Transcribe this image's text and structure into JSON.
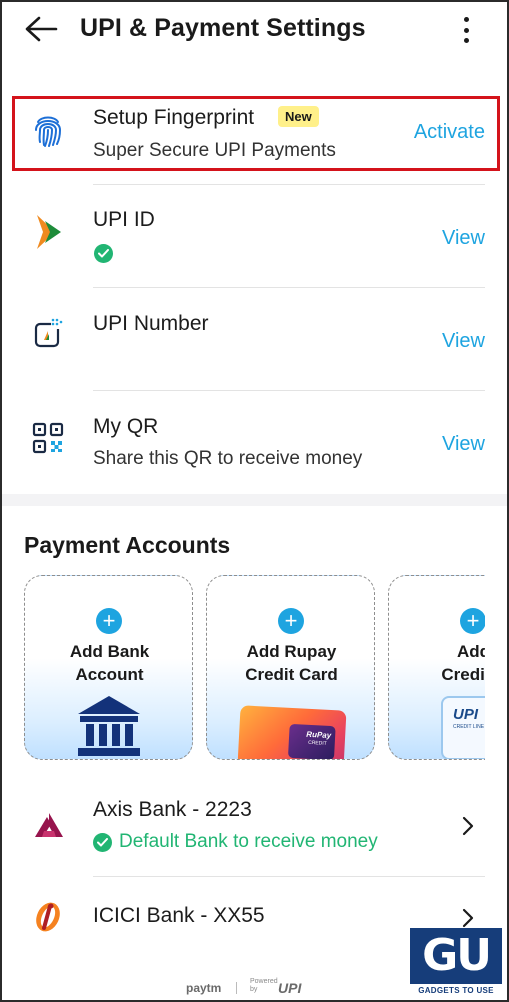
{
  "header": {
    "title": "UPI & Payment Settings",
    "back_icon": "arrow-left-icon",
    "menu_icon": "more-vertical-icon"
  },
  "settings": {
    "fingerprint": {
      "title": "Setup Fingerprint",
      "badge": "New",
      "subtitle": "Super Secure UPI Payments",
      "action": "Activate",
      "icon": "fingerprint-icon"
    },
    "upi_id": {
      "title": "UPI ID",
      "action": "View",
      "icon": "bhim-upi-icon",
      "status_icon": "check-circle-icon"
    },
    "upi_number": {
      "title": "UPI Number",
      "action": "View",
      "icon": "phone-number-icon"
    },
    "my_qr": {
      "title": "My QR",
      "subtitle": "Share this QR to receive money",
      "action": "View",
      "icon": "qr-code-icon"
    }
  },
  "payment_accounts": {
    "title": "Payment Accounts",
    "cards": [
      {
        "line1": "Add Bank",
        "line2": "Account",
        "icon": "bank-building-icon"
      },
      {
        "line1": "Add Rupay",
        "line2": "Credit Card",
        "icon": "rupay-card-icon",
        "card_text": "RuPay",
        "card_sub": "CREDIT"
      },
      {
        "line1": "Add",
        "line2": "Credit L",
        "icon": "upi-credit-line-icon",
        "card_text": "UPI",
        "card_sub": "CREDIT LINE"
      }
    ]
  },
  "banks": [
    {
      "name": "Axis Bank - 2223",
      "status": "Default Bank to receive money",
      "icon": "axis-bank-logo"
    },
    {
      "name": "ICICI Bank - XX55",
      "icon": "icici-bank-logo"
    }
  ],
  "footer": {
    "paytm": "paytm",
    "powered": "Powered\nby",
    "upi": "UPI"
  },
  "watermark": {
    "logo": "GU",
    "text": "GADGETS TO USE"
  },
  "colors": {
    "accent": "#1ea4e0",
    "success": "#21b573",
    "highlight": "#d4131b",
    "badge": "#fff08a"
  }
}
